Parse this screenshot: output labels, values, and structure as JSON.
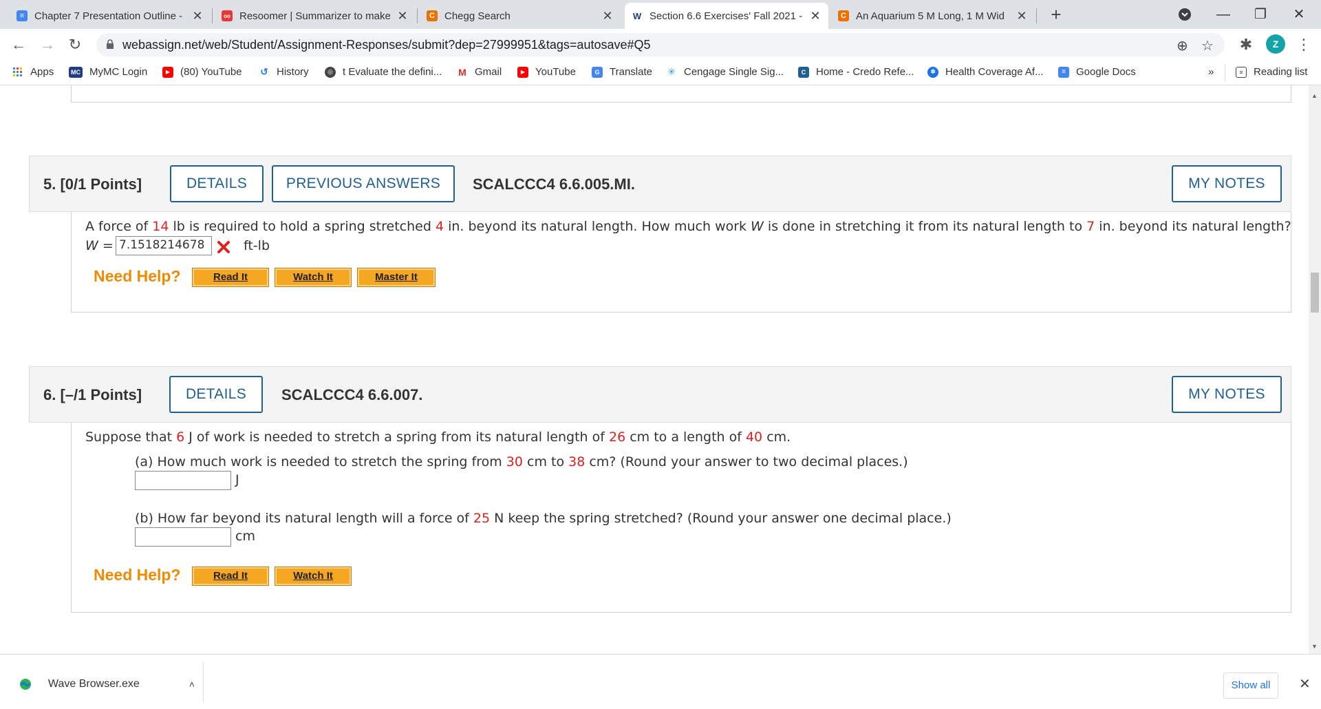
{
  "browser": {
    "tabs": [
      {
        "title": "Chapter 7 Presentation Outline -",
        "favicon_color": "#4285f4",
        "favicon_glyph": "≡"
      },
      {
        "title": "Resoomer | Summarizer to make",
        "favicon_color": "#e53935",
        "favicon_glyph": "oo"
      },
      {
        "title": "Chegg Search",
        "favicon_color": "#eb7100",
        "favicon_glyph": "C"
      },
      {
        "title": "Section 6.6 Exercises' Fall 2021 -",
        "favicon_color": "#1f3b8a",
        "favicon_glyph": "W"
      },
      {
        "title": "An Aquarium 5 M Long, 1 M Wid",
        "favicon_color": "#eb7100",
        "favicon_glyph": "C"
      }
    ],
    "new_tab": "+",
    "url": "webassign.net/web/Student/Assignment-Responses/submit?dep=27999951&tags=autosave#Q5",
    "profile_initial": "Z",
    "bookmarks": [
      {
        "label": "Apps",
        "icon": "apps-grid-icon",
        "color": "#4285f4"
      },
      {
        "label": "MyMC Login",
        "icon": "mc-icon",
        "color": "#1f3b8a"
      },
      {
        "label": "(80) YouTube",
        "icon": "youtube-icon",
        "color": "#ff0000"
      },
      {
        "label": "History",
        "icon": "history-icon",
        "color": "#1a73e8"
      },
      {
        "label": "t Evaluate the defini...",
        "icon": "globe-icon",
        "color": "#444444"
      },
      {
        "label": "Gmail",
        "icon": "gmail-icon",
        "color": "#d93025"
      },
      {
        "label": "YouTube",
        "icon": "youtube-icon",
        "color": "#ff0000"
      },
      {
        "label": "Translate",
        "icon": "translate-icon",
        "color": "#4285f4"
      },
      {
        "label": "Cengage Single Sig...",
        "icon": "cengage-icon",
        "color": "#1aa3d9"
      },
      {
        "label": "Home - Credo Refe...",
        "icon": "credo-icon",
        "color": "#1f5f91"
      },
      {
        "label": "Health Coverage Af...",
        "icon": "health-icon",
        "color": "#1a73e8"
      },
      {
        "label": "Google Docs",
        "icon": "docs-icon",
        "color": "#4285f4"
      }
    ],
    "bookmarks_more": "»",
    "reading_list": "Reading list"
  },
  "questions": [
    {
      "number": "5.",
      "points": "[0/1 Points]",
      "details_label": "DETAILS",
      "previous_label": "PREVIOUS ANSWERS",
      "code": "SCALCCC4 6.6.005.MI.",
      "notes_label": "MY NOTES",
      "text": {
        "p1": "A force of ",
        "force": "14",
        "p2": " lb is required to hold a spring stretched ",
        "stretch": "4",
        "p3": " in. beyond its natural length. How much work ",
        "var": "W",
        "p4": " is done in stretching it from its natural length to ",
        "to": "7",
        "p5": " in. beyond its natural length?"
      },
      "answer_label": "W =",
      "answer_value": "7.1518214678",
      "answer_unit": "ft-lb",
      "answer_status": "incorrect",
      "need_help": "Need Help?",
      "help_buttons": [
        "Read It",
        "Watch It",
        "Master It"
      ]
    },
    {
      "number": "6.",
      "points": "[–/1 Points]",
      "details_label": "DETAILS",
      "code": "SCALCCC4 6.6.007.",
      "notes_label": "MY NOTES",
      "text": {
        "p1": "Suppose that ",
        "work": "6",
        "p2": " J of work is needed to stretch a spring from its natural length of ",
        "natural": "26",
        "p3": " cm to a length of ",
        "length": "40",
        "p4": " cm."
      },
      "part_a": {
        "p1": "(a) How much work is needed to stretch the spring from ",
        "from": "30",
        "p2": " cm to ",
        "to": "38",
        "p3": " cm? (Round your answer to two decimal places.)",
        "value": "",
        "unit": "J"
      },
      "part_b": {
        "p1": "(b) How far beyond its natural length will a force of ",
        "force": "25",
        "p2": " N keep the spring stretched? (Round your answer one decimal place.)",
        "value": "",
        "unit": "cm"
      },
      "need_help": "Need Help?",
      "help_buttons": [
        "Read It",
        "Watch It"
      ]
    }
  ],
  "downloads": {
    "file": "Wave Browser.exe",
    "show_all": "Show all"
  }
}
